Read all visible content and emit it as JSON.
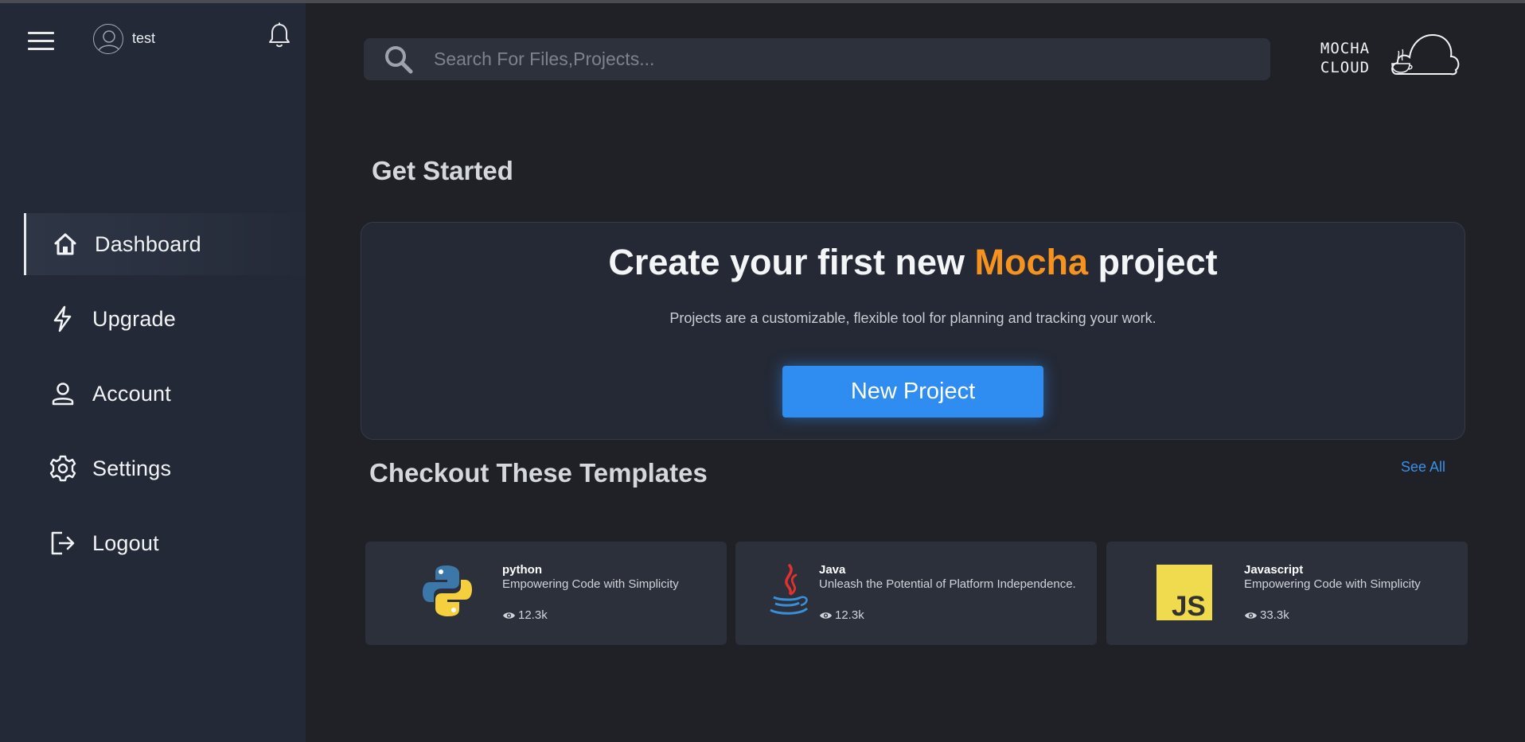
{
  "sidebar": {
    "username": "test",
    "items": [
      {
        "label": "Dashboard",
        "icon": "home-icon",
        "active": true
      },
      {
        "label": "Upgrade",
        "icon": "lightning-icon",
        "active": false
      },
      {
        "label": "Account",
        "icon": "user-icon",
        "active": false
      },
      {
        "label": "Settings",
        "icon": "gear-icon",
        "active": false
      },
      {
        "label": "Logout",
        "icon": "logout-icon",
        "active": false
      }
    ]
  },
  "search": {
    "placeholder": "Search For Files,Projects...",
    "value": ""
  },
  "logo": {
    "line1": "MOCHA",
    "line2": "CLOUD"
  },
  "get_started": {
    "heading": "Get Started",
    "title_prefix": "Create your first new ",
    "title_accent": "Mocha",
    "title_suffix": " project",
    "subtitle": "Projects are a customizable, flexible tool for planning and tracking your work.",
    "button_label": "New Project"
  },
  "templates": {
    "heading": "Checkout These Templates",
    "see_all": "See All",
    "items": [
      {
        "name": "python",
        "description": "Empowering Code with Simplicity",
        "views": "12.3k",
        "icon": "python-logo-icon"
      },
      {
        "name": "Java",
        "description": "Unleash the Potential of Platform Independence.",
        "views": "12.3k",
        "icon": "java-logo-icon"
      },
      {
        "name": "Javascript",
        "description": "Empowering Code with Simplicity",
        "views": "33.3k",
        "icon": "javascript-logo-icon"
      }
    ]
  },
  "colors": {
    "background": "#1f2127",
    "sidebar": "#232936",
    "accent_orange": "#f6921e",
    "button_blue": "#2f8cf0",
    "link_blue": "#3a8fe8"
  }
}
